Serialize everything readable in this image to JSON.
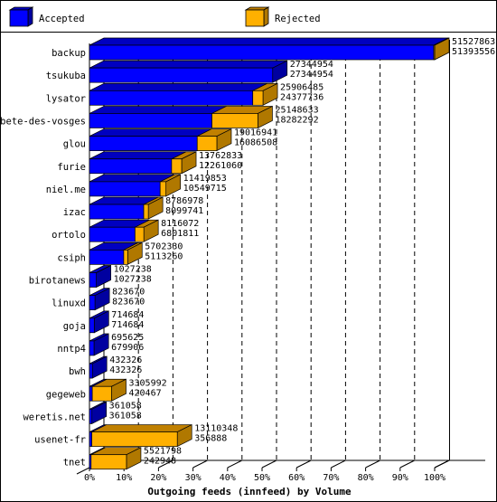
{
  "chart_data": {
    "type": "bar",
    "orientation": "horizontal",
    "stacked": true,
    "three_d": true,
    "title": "Outgoing feeds (innfeed) by Volume",
    "xlabel": "Outgoing feeds (innfeed) by Volume",
    "ylabel": "",
    "xlim": [
      0,
      100
    ],
    "x_unit": "% of maximum total",
    "x_ticks": [
      "0%",
      "10%",
      "20%",
      "30%",
      "40%",
      "50%",
      "60%",
      "70%",
      "80%",
      "90%",
      "100%"
    ],
    "grid": "vertical dashed",
    "legend": {
      "placement": "top",
      "entries": [
        {
          "name": "Accepted",
          "color": "#0000ff"
        },
        {
          "name": "Rejected",
          "color": "#ffb000"
        }
      ]
    },
    "colors": {
      "accepted_front": "#0000ff",
      "accepted_top": "#0000c0",
      "accepted_side": "#0000a0",
      "rejected_front": "#ffb000",
      "rejected_top": "#c08000",
      "rejected_side": "#b07800"
    },
    "categories": [
      "backup",
      "tsukuba",
      "lysator",
      "bete-des-vosges",
      "glou",
      "furie",
      "niel.me",
      "izac",
      "ortolo",
      "csiph",
      "birotanews",
      "linuxd",
      "goja",
      "nntp4",
      "bwh",
      "gegeweb",
      "weretis.net",
      "usenet-fr",
      "tnet"
    ],
    "totals": [
      51527863,
      27344954,
      25906485,
      25148633,
      19016941,
      13762833,
      11419853,
      8786978,
      8116072,
      5702330,
      1027238,
      823670,
      714684,
      695625,
      432326,
      3305992,
      361058,
      13110348,
      5521798
    ],
    "series": [
      {
        "name": "Accepted",
        "values": [
          51393556,
          27344954,
          24377736,
          18282292,
          16086508,
          12261060,
          10549715,
          8099741,
          6801811,
          5113260,
          1027238,
          823670,
          714684,
          679906,
          432326,
          420467,
          361058,
          356888,
          242948
        ]
      },
      {
        "name": "Rejected",
        "values": [
          134307,
          0,
          1528749,
          6866341,
          2930433,
          1501773,
          870138,
          687237,
          1314261,
          589070,
          0,
          0,
          0,
          15719,
          0,
          2885525,
          0,
          12753460,
          5278850
        ]
      }
    ],
    "value_labels": [
      [
        "51527863",
        "51393556"
      ],
      [
        "27344954",
        "27344954"
      ],
      [
        "25906485",
        "24377736"
      ],
      [
        "25148633",
        "18282292"
      ],
      [
        "19016941",
        "16086508"
      ],
      [
        "13762833",
        "12261060"
      ],
      [
        "11419853",
        "10549715"
      ],
      [
        "8786978",
        "8099741"
      ],
      [
        "8116072",
        "6801811"
      ],
      [
        "5702330",
        "5113260"
      ],
      [
        "1027238",
        "1027238"
      ],
      [
        "823670",
        "823670"
      ],
      [
        "714684",
        "714684"
      ],
      [
        "695625",
        "679906"
      ],
      [
        "432326",
        "432326"
      ],
      [
        "3305992",
        "420467"
      ],
      [
        "361058",
        "361058"
      ],
      [
        "13110348",
        "356888"
      ],
      [
        "5521798",
        "242948"
      ]
    ]
  }
}
